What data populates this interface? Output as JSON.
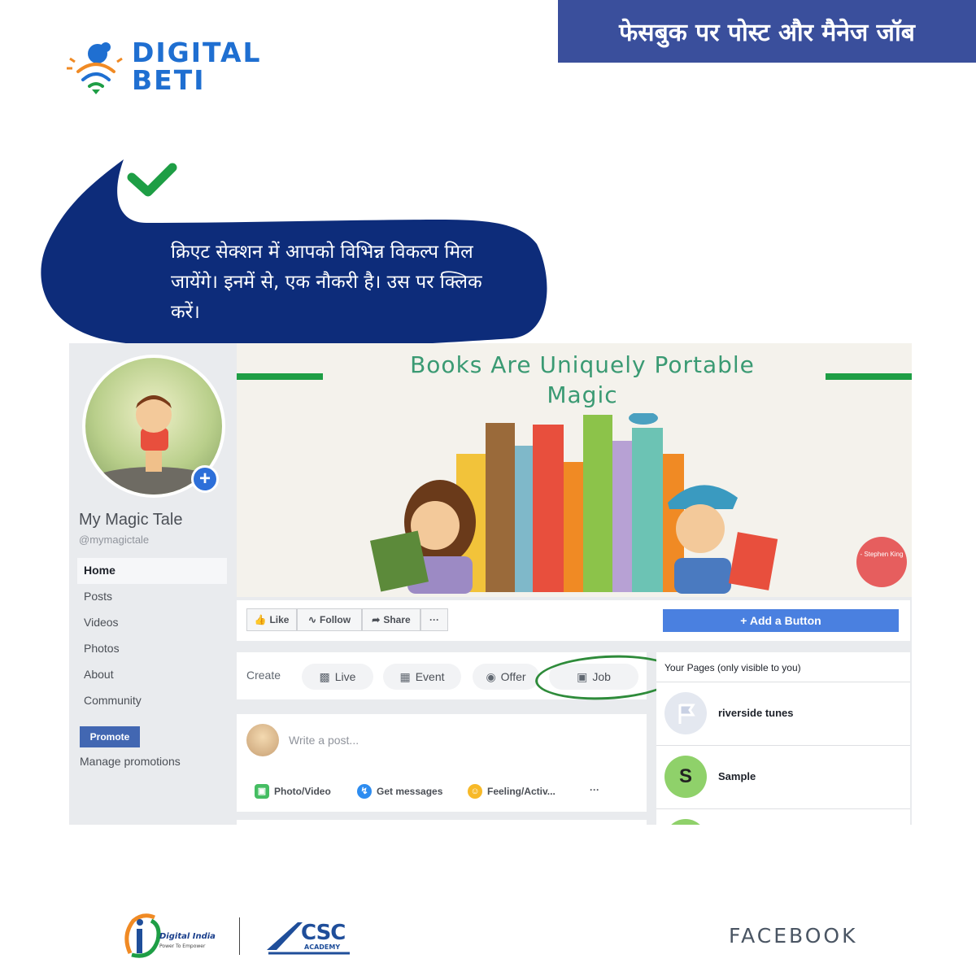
{
  "brand": {
    "logo_line1": "DIGITAL",
    "logo_line2": "BETI",
    "banner_title": "फेसबुक पर पोस्ट और मैनेज जॉब",
    "accent_blue": "#1f6fd1",
    "banner_color": "#3a4f9c",
    "bubble_color": "#0d2c7a",
    "check_color": "#1e9e45"
  },
  "bubble": {
    "text": "क्रिएट सेक्शन में आपको विभिन्न विकल्प मिल जायेंगे। इनमें से, एक नौकरी है। उस पर क्लिक करें।"
  },
  "screenshot": {
    "page_name": "My Magic Tale",
    "page_handle": "@mymagictale",
    "nav": [
      "Home",
      "Posts",
      "Videos",
      "Photos",
      "About",
      "Community"
    ],
    "promote_label": "Promote",
    "manage_label": "Manage promotions",
    "cover": {
      "title": "Books Are Uniquely Portable Magic",
      "badge": "- Stephen King"
    },
    "actions": {
      "like": "Like",
      "follow": "Follow",
      "share": "Share",
      "more": "···",
      "add_button": "+ Add a Button"
    },
    "create": {
      "label": "Create",
      "items": [
        {
          "label": "Live",
          "icon": "video-camera-icon"
        },
        {
          "label": "Event",
          "icon": "calendar-icon"
        },
        {
          "label": "Offer",
          "icon": "percent-icon"
        },
        {
          "label": "Job",
          "icon": "briefcase-icon"
        }
      ]
    },
    "post": {
      "placeholder": "Write a post...",
      "photo_video": "Photo/Video",
      "get_messages": "Get messages",
      "feeling": "Feeling/Activ...",
      "more": "···"
    },
    "your_pages": {
      "heading": "Your Pages (only visible to you)",
      "items": [
        {
          "name": "riverside tunes",
          "avatar": "flag-icon"
        },
        {
          "name": "Sample",
          "avatar": "S"
        }
      ]
    }
  },
  "footer": {
    "digital_india": "Digital India",
    "digital_india_sub": "Power To Empower",
    "csc": "CSC",
    "csc_sub": "ACADEMY",
    "facebook": "FACEBOOK"
  }
}
